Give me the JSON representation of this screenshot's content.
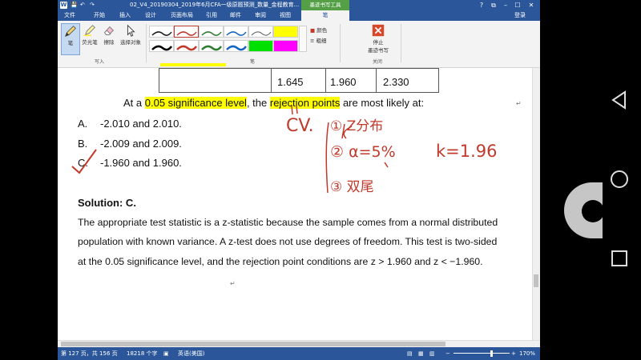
{
  "titlebar": {
    "quick_save": "💾",
    "quick_undo": "↶",
    "quick_redo": "↷",
    "document_title": "02_V4_20190304_2019年6月CFA一级原题预测_数量_金程教育...",
    "context_tab": "墨迹书写工具",
    "help": "?",
    "restore": "⧉",
    "minimize": "–",
    "maximize": "☐",
    "close": "✕"
  },
  "tabs": [
    {
      "label": "文件"
    },
    {
      "label": "开始"
    },
    {
      "label": "插入"
    },
    {
      "label": "设计"
    },
    {
      "label": "页面布局"
    },
    {
      "label": "引用"
    },
    {
      "label": "邮件"
    },
    {
      "label": "审阅"
    },
    {
      "label": "视图"
    },
    {
      "label": "笔"
    }
  ],
  "login": "登录",
  "ribbon": {
    "write_group": {
      "label": "写入",
      "pen": "笔",
      "highlighter": "荧光笔",
      "eraser": "擦除",
      "select": "选择对象"
    },
    "pens_group_label": "笔",
    "color_label": "颜色",
    "thickness_label": "粗细",
    "close_group": {
      "label": "关闭",
      "stop_inking_line1": "停止",
      "stop_inking_line2": "墨迹书写"
    },
    "accent_color": "#c0392b",
    "pen_colors": [
      "#1a1a1a",
      "#c0392b",
      "#2e7d32",
      "#1565c0",
      "#1a1a1a",
      "#ffff00",
      "#000000",
      "#00e000",
      "#ff00ff"
    ]
  },
  "document": {
    "table_values": [
      "1.645",
      "1.960",
      "2.330"
    ],
    "question_prefix": "At a ",
    "question_hl1": "0.05 significance level",
    "question_mid": ", the ",
    "question_hl2": "rejection points",
    "question_suffix": " are most likely at:",
    "options": [
      {
        "letter": "A.",
        "text": "-2.010 and 2.010."
      },
      {
        "letter": "B.",
        "text": "-2.009 and 2.009."
      },
      {
        "letter": "C.",
        "text": "-1.960 and 1.960."
      }
    ],
    "solution_heading": "Solution: C.",
    "solution_lines": [
      "The appropriate test statistic is a z-statistic because the sample comes from a normal distributed",
      "population with known variance. A z-test does not use degrees of freedom. This test is two-sided",
      "at the 0.05 significance level, and the rejection point conditions are z > 1.960 and z < −1.960."
    ],
    "handwriting": {
      "cv": "CV.",
      "item1": "① Z分布",
      "item2": "② α=5%",
      "item3": "③ 双尾",
      "k_value": "k=1.96",
      "ink_color": "#c0392b"
    }
  },
  "statusbar": {
    "page": "第 127 页，共 156 页",
    "words": "18218 个字",
    "language": "英语(美国)",
    "zoom": "170%",
    "zoom_minus": "−",
    "zoom_plus": "+"
  },
  "android_nav": {
    "back": "back-icon",
    "home": "home-icon",
    "recents": "recents-icon"
  }
}
